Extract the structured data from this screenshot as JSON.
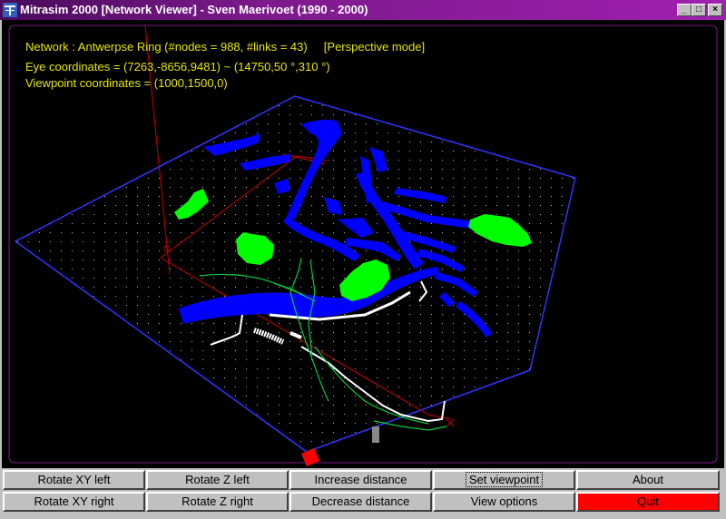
{
  "window": {
    "title": "Mitrasim 2000 [Network Viewer] - Sven Maerivoet (1990 - 2000)",
    "controls": [
      "_",
      "□",
      "×"
    ]
  },
  "viewer": {
    "info_network": "Network : Antwerpse Ring (#nodes = 988, #links = 43)     [Perspective mode]",
    "info_eye": "Eye coordinates = (7263,-8656,9481) ~ (14750,50 °,310 °)",
    "info_viewpoint": "Viewpoint coordinates = (1000,1500,0)",
    "colors": {
      "text": "#e6e600",
      "water": "#0000ff",
      "parks": "#00ff00",
      "roads": "#ffffff",
      "axes": "#cc0000",
      "border": "#3333ff",
      "grid": "#cccccc"
    }
  },
  "buttons": {
    "rotate_xy_left": "Rotate XY left",
    "rotate_z_left": "Rotate Z left",
    "increase_distance": "Increase distance",
    "set_viewpoint": "Set viewpoint",
    "about": "About",
    "rotate_xy_right": "Rotate XY right",
    "rotate_z_right": "Rotate Z right",
    "decrease_distance": "Decrease distance",
    "view_options": "View options",
    "quit": "Quit"
  }
}
